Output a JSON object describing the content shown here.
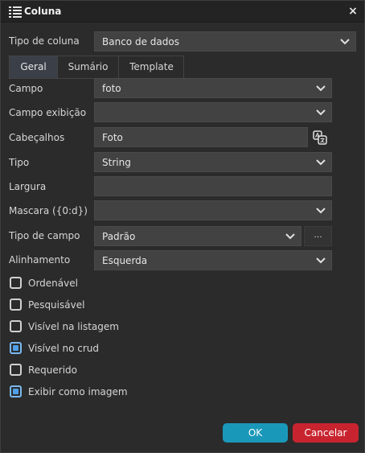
{
  "window": {
    "title": "Coluna",
    "close_symbol": "×"
  },
  "column_type": {
    "label": "Tipo de coluna",
    "value": "Banco de dados"
  },
  "tabs": [
    {
      "label": "Geral",
      "active": true
    },
    {
      "label": "Sumário",
      "active": false
    },
    {
      "label": "Template",
      "active": false
    }
  ],
  "fields": {
    "campo": {
      "label": "Campo",
      "value": "foto"
    },
    "campo_exibicao": {
      "label": "Campo exibição",
      "value": ""
    },
    "cabecalhos": {
      "label": "Cabeçalhos",
      "value": "Foto"
    },
    "tipo": {
      "label": "Tipo",
      "value": "String"
    },
    "largura": {
      "label": "Largura",
      "value": ""
    },
    "mascara": {
      "label": "Mascara ({0:d})",
      "value": ""
    },
    "tipo_campo": {
      "label": "Tipo de campo",
      "value": "Padrão",
      "extra_button": "..."
    },
    "alinhamento": {
      "label": "Alinhamento",
      "value": "Esquerda"
    }
  },
  "checkboxes": [
    {
      "label": "Ordenável",
      "checked": false
    },
    {
      "label": "Pesquisável",
      "checked": false
    },
    {
      "label": "Visível na listagem",
      "checked": false
    },
    {
      "label": "Visível no crud",
      "checked": true
    },
    {
      "label": "Requerido",
      "checked": false
    },
    {
      "label": "Exibir como imagem",
      "checked": true
    }
  ],
  "buttons": {
    "ok": "OK",
    "cancel": "Cancelar"
  },
  "colors": {
    "ok": "#1a98b9",
    "cancel": "#c8242f",
    "checked": "#4f9ee8"
  }
}
